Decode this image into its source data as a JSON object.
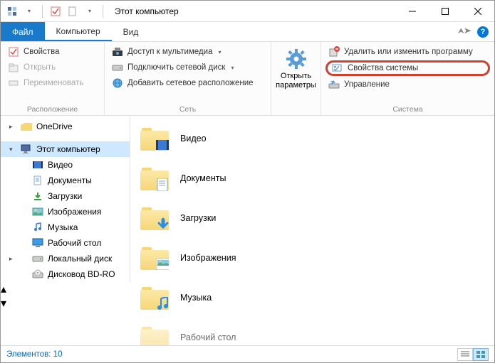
{
  "titlebar": {
    "title": "Этот компьютер"
  },
  "tabs": {
    "file": "Файл",
    "computer": "Компьютер",
    "view": "Вид"
  },
  "ribbon": {
    "location": {
      "label": "Расположение",
      "properties": "Свойства",
      "open": "Открыть",
      "rename": "Переименовать"
    },
    "network": {
      "label": "Сеть",
      "media": "Доступ к мультимедиа",
      "map_drive": "Подключить сетевой диск",
      "add_location": "Добавить сетевое расположение"
    },
    "open_settings": {
      "label": "Открыть параметры"
    },
    "system": {
      "label": "Система",
      "uninstall": "Удалить или изменить программу",
      "sysprops": "Свойства системы",
      "manage": "Управление"
    }
  },
  "tree": {
    "onedrive": "OneDrive",
    "thispc": "Этот компьютер",
    "video": "Видео",
    "documents": "Документы",
    "downloads": "Загрузки",
    "pictures": "Изображения",
    "music": "Музыка",
    "desktop": "Рабочий стол",
    "localdisk": "Локальный диск",
    "bdrom": "Дисковод BD-RO"
  },
  "main": {
    "video": "Видео",
    "documents": "Документы",
    "downloads": "Загрузки",
    "pictures": "Изображения",
    "music": "Музыка",
    "desktop": "Рабочий стол"
  },
  "status": {
    "items": "Элементов: 10"
  }
}
